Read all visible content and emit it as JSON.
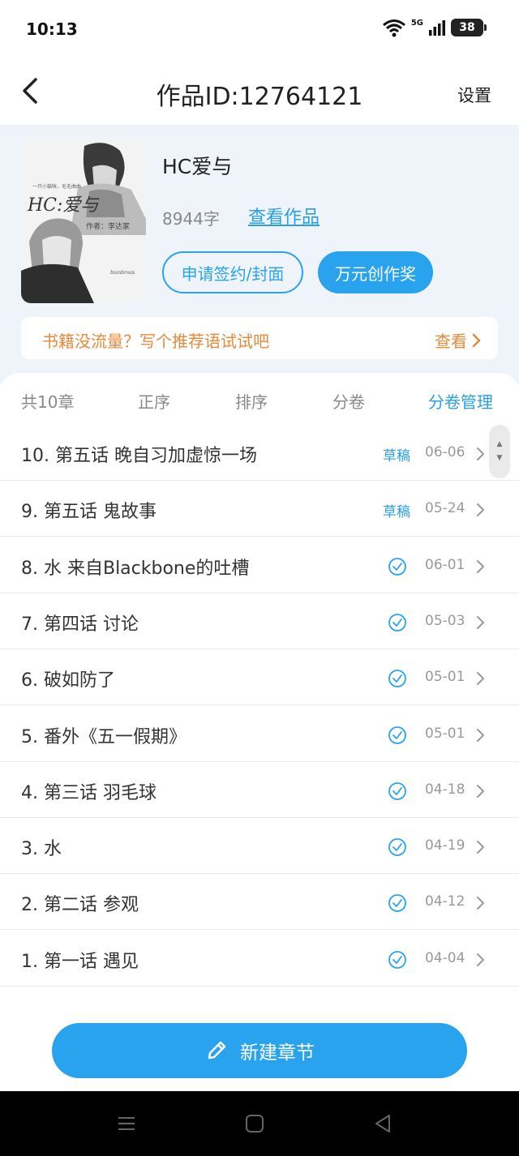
{
  "status_bar": {
    "time": "10:13",
    "network": "5G",
    "battery": "38"
  },
  "nav": {
    "title": "作品ID:12764121",
    "settings": "设置"
  },
  "book": {
    "title": "HC爱与",
    "word_count": "8944字",
    "view_link": "查看作品",
    "cover_text": "HC:爱与",
    "cover_subtitle": "作者：李达家",
    "cover_note": "一只小猫咪，毛毛曲曲",
    "cover_credit": "bianbroas"
  },
  "buttons": {
    "apply_sign": "申请签约/封面",
    "award": "万元创作奖",
    "new_chapter": "新建章节"
  },
  "promo": {
    "text": "书籍没流量？写个推荐语试试吧",
    "link": "查看"
  },
  "filters": {
    "count": "共10章",
    "order": "正序",
    "sort": "排序",
    "volume": "分卷",
    "manage": "分卷管理"
  },
  "chapters": [
    {
      "title": "10. 第五话 晚自习加虚惊一场",
      "status": "草稿",
      "date": "06-06"
    },
    {
      "title": "9. 第五话 鬼故事",
      "status": "草稿",
      "date": "05-24"
    },
    {
      "title": "8. 水 来自Blackbone的吐槽",
      "status": "published",
      "date": "06-01"
    },
    {
      "title": "7. 第四话 讨论",
      "status": "published",
      "date": "05-03"
    },
    {
      "title": "6. 破如防了",
      "status": "published",
      "date": "05-01"
    },
    {
      "title": "5. 番外《五一假期》",
      "status": "published",
      "date": "05-01"
    },
    {
      "title": "4. 第三话 羽毛球",
      "status": "published",
      "date": "04-18"
    },
    {
      "title": "3. 水",
      "status": "published",
      "date": "04-19"
    },
    {
      "title": "2. 第二话 参观",
      "status": "published",
      "date": "04-12"
    },
    {
      "title": "1. 第一话 遇见",
      "status": "published",
      "date": "04-04"
    }
  ],
  "colors": {
    "accent": "#2aa3ee",
    "promo": "#e8893a",
    "header_bg": "#eef4fa"
  },
  "icons": {
    "back": "back-arrow-icon",
    "published": "check-circle-icon",
    "chevron": "chevron-right-icon",
    "pencil": "pencil-icon"
  }
}
